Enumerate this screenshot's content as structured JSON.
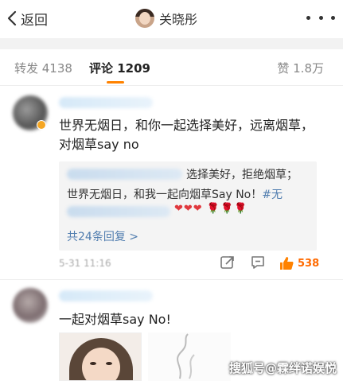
{
  "header": {
    "back_label": "返回",
    "author_name": "关晓彤",
    "more_icon": "more-icon"
  },
  "tabs": {
    "repost": "转发 4138",
    "comment": "评论 1209",
    "like": "赞 1.8万"
  },
  "comments": [
    {
      "text": "世界无烟日，和你一起选择美好，远离烟草，对烟草say no",
      "reply": {
        "line1": "选择美好，拒绝烟草；",
        "line2_prefix": "世界无烟日，和我一起向烟草Say No！",
        "line2_tag": "#无",
        "emoji": "❤❤❤",
        "roses": "🌹🌹🌹",
        "more": "共24条回复 >"
      },
      "time": "5-31 11:16",
      "likes": "538"
    },
    {
      "text": "一起对烟草say No!"
    }
  ],
  "watermark": "搜狐号@霖绊诺娱悦",
  "colors": {
    "accent": "#ff8200",
    "link": "#507daf",
    "like": "#ff6a00"
  }
}
